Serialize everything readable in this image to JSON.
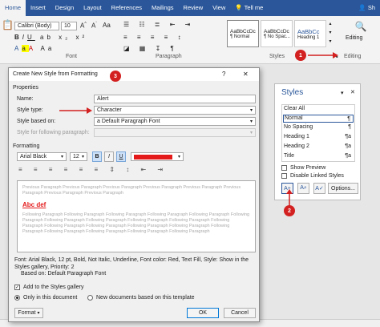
{
  "ribbon": {
    "tabs": [
      "Home",
      "Insert",
      "Design",
      "Layout",
      "References",
      "Mailings",
      "Review",
      "View",
      "Tell me"
    ],
    "font_name": "Calibri (Body)",
    "font_size": "10",
    "group_font": "Font",
    "group_paragraph": "Paragraph",
    "group_styles": "Styles",
    "group_editing": "Editing",
    "editing_label": "Editing",
    "user": "Sh",
    "gallery": [
      {
        "sample": "AaBbCcDc",
        "name": "¶ Normal"
      },
      {
        "sample": "AaBbCcDc",
        "name": "¶ No Spac..."
      },
      {
        "sample": "AaBbCc",
        "name": "Heading 1"
      }
    ]
  },
  "dialog": {
    "title": "Create New Style from Formatting",
    "help": "?",
    "close": "✕",
    "properties_label": "Properties",
    "name_label": "Name:",
    "name_value": "Alert",
    "type_label": "Style type:",
    "type_value": "Character",
    "based_label": "Style based on:",
    "based_value": "a  Default Paragraph Font",
    "following_label": "Style for following paragraph:",
    "formatting_label": "Formatting",
    "fmt_font": "Arial Black",
    "fmt_size": "12",
    "fmt_bold": "B",
    "fmt_italic": "I",
    "fmt_underline": "U",
    "fmt_color": "#e41a1a",
    "preview_prev": "Previous Paragraph Previous Paragraph Previous Paragraph Previous Paragraph Previous Paragraph Previous Paragraph Previous Paragraph Previous Paragraph",
    "preview_sample": "Abc def",
    "preview_follow": "Following Paragraph Following Paragraph Following Paragraph Following Paragraph Following Paragraph Following Paragraph Following Paragraph Following Paragraph Following Paragraph Following Paragraph Following Paragraph Following Paragraph Following Paragraph Following Paragraph Following Paragraph Following Paragraph Following Paragraph Following Paragraph Following Paragraph Following Paragraph",
    "description_line1": "Font: Arial Black, 12 pt, Bold, Not Italic, Underline, Font color: Red, Text Fill, Style: Show in the",
    "description_line2": "Styles gallery, Priority: 2",
    "description_line3": "Based on: Default Paragraph Font",
    "add_gallery_label": "Add to the Styles gallery",
    "only_doc_label": "Only in this document",
    "new_docs_label": "New documents based on this template",
    "format_button": "Format",
    "ok_button": "OK",
    "cancel_button": "Cancel"
  },
  "styles_pane": {
    "title": "Styles",
    "items": [
      {
        "name": "Clear All",
        "mark": ""
      },
      {
        "name": "Normal",
        "mark": "¶"
      },
      {
        "name": "No Spacing",
        "mark": "¶"
      },
      {
        "name": "Heading 1",
        "mark": "¶a"
      },
      {
        "name": "Heading 2",
        "mark": "¶a"
      },
      {
        "name": "Title",
        "mark": "¶a"
      }
    ],
    "show_preview": "Show Preview",
    "disable_linked": "Disable Linked Styles",
    "options_button": "Options..."
  },
  "badges": {
    "b1": "1",
    "b2": "2",
    "b3": "3"
  },
  "colors": {
    "accent": "#2b579a",
    "badge": "#d32020",
    "arrow": "#d32020",
    "selected_border": "#2b579a"
  }
}
